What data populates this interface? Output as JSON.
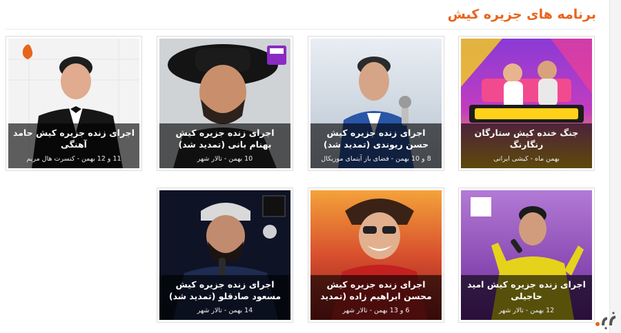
{
  "section": {
    "title": "برنامه های جزیره کیش"
  },
  "events": [
    {
      "title": "جنگ خنده کیش ستارگان رنگارنگ",
      "info": "بهمن ماه - کیشی ایرانی"
    },
    {
      "title": "اجرای زنده جزیره کیش حسن ریوندی (تمدید شد)",
      "info": "8 و 10 بهمن - فضای باز آیتمای موزیکال"
    },
    {
      "title": "اجرای زنده جزیره کیش بهنام بانی (تمدید شد)",
      "info": "10 بهمن - تالار شهر"
    },
    {
      "title": "اجرای زنده جزیره کیش حامد آهنگی",
      "info": "11 و 12 بهمن - کنسرت هال مریم"
    },
    {
      "title": "اجرای زنده جزیره کیش امید حاجیلی",
      "info": "12 بهمن - تالار شهر"
    },
    {
      "title": "اجرای زنده جزیره کیش محسن ابراهیم زاده (تمدید شد)",
      "info": "6 و 13 بهمن - تالار شهر"
    },
    {
      "title": "اجرای زنده جزیره کیش مسعود صادقلو (تمدید شد)",
      "info": "14 بهمن - تالار شهر"
    }
  ],
  "colors": {
    "accent": "#e8641b",
    "caption_overlay": "rgba(0,0,0,0.62)",
    "card_border": "#dcdcdc"
  }
}
